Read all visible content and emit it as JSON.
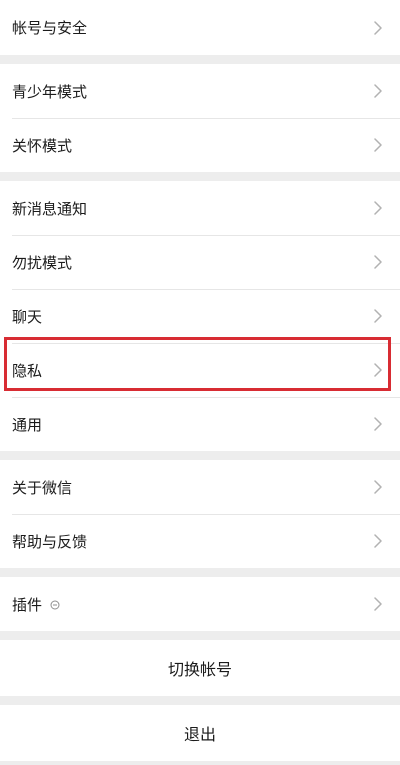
{
  "groups": [
    {
      "items": [
        {
          "label": "帐号与安全"
        }
      ]
    },
    {
      "items": [
        {
          "label": "青少年模式"
        },
        {
          "label": "关怀模式"
        }
      ]
    },
    {
      "items": [
        {
          "label": "新消息通知"
        },
        {
          "label": "勿扰模式"
        },
        {
          "label": "聊天"
        },
        {
          "label": "隐私"
        },
        {
          "label": "通用"
        }
      ]
    },
    {
      "items": [
        {
          "label": "关于微信"
        },
        {
          "label": "帮助与反馈"
        }
      ]
    },
    {
      "items": [
        {
          "label": "插件"
        }
      ]
    }
  ],
  "actions": {
    "switch_account": "切换帐号",
    "logout": "退出"
  },
  "colors": {
    "background": "#ededed",
    "row_background": "#ffffff",
    "text": "#1b1b1b",
    "chevron": "#b2b2b2",
    "highlight": "#d82c33"
  },
  "icons": {
    "chevron": "chevron-right-icon",
    "plugin_badge": "plugin-badge-icon"
  }
}
